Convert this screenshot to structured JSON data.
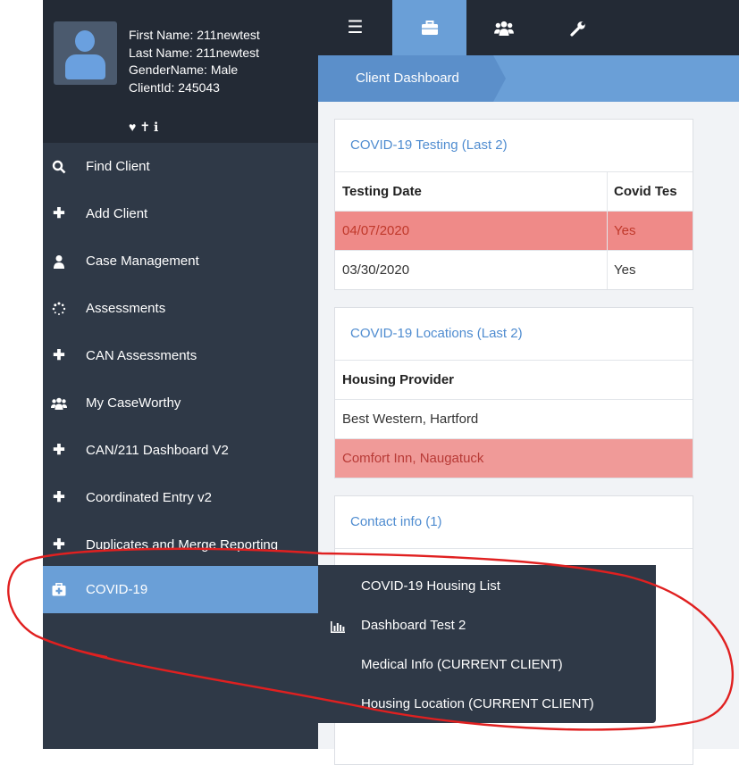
{
  "profile": {
    "first_name": "First Name: 211newtest",
    "last_name": "Last Name: 211newtest",
    "gender": "GenderName: Male",
    "client_id": "ClientId: 245043",
    "icons": [
      "heart-icon",
      "person-icon",
      "info-icon"
    ]
  },
  "sidebar": {
    "items": [
      {
        "label": "Find Client",
        "icon": "search-icon"
      },
      {
        "label": "Add Client",
        "icon": "plus-icon"
      },
      {
        "label": "Case Management",
        "icon": "user-icon"
      },
      {
        "label": "Assessments",
        "icon": "spinner-icon"
      },
      {
        "label": "CAN Assessments",
        "icon": "plus-icon"
      },
      {
        "label": "My CaseWorthy",
        "icon": "users-icon"
      },
      {
        "label": "CAN/211 Dashboard V2",
        "icon": "plus-icon"
      },
      {
        "label": "Coordinated Entry v2",
        "icon": "plus-icon"
      },
      {
        "label": "Duplicates and Merge Reporting",
        "icon": "plus-icon"
      },
      {
        "label": "COVID-19",
        "icon": "medkit-icon",
        "active": true
      }
    ]
  },
  "topbar": {
    "buttons": [
      "menu-icon",
      "briefcase-icon",
      "users-icon",
      "wrench-icon"
    ],
    "active_index": 1
  },
  "breadcrumb": {
    "label": "Client Dashboard"
  },
  "panels": {
    "testing": {
      "title": "COVID-19 Testing (Last 2)",
      "headers": [
        "Testing Date",
        "Covid Tes"
      ],
      "rows": [
        {
          "date": "04/07/2020",
          "value": "Yes",
          "highlight": true
        },
        {
          "date": "03/30/2020",
          "value": "Yes",
          "highlight": false
        }
      ]
    },
    "locations": {
      "title": "COVID-19 Locations (Last 2)",
      "header": "Housing Provider",
      "rows": [
        {
          "provider": "Best Western, Hartford",
          "highlight": false
        },
        {
          "provider": "Comfort Inn, Naugatuck",
          "highlight": true
        }
      ]
    },
    "contact": {
      "title": "Contact info (1)"
    }
  },
  "submenu": {
    "items": [
      {
        "label": "COVID-19 Housing List",
        "icon": ""
      },
      {
        "label": "Dashboard Test 2",
        "icon": "bar-chart-icon"
      },
      {
        "label": "Medical Info (CURRENT CLIENT)",
        "icon": ""
      },
      {
        "label": "Housing Location (CURRENT CLIENT)",
        "icon": ""
      }
    ]
  },
  "colors": {
    "sidebar": "#2f3947",
    "profile": "#232a35",
    "accent": "#6a9fd7",
    "highlight_row": "#ef8a88",
    "annotation": "#e02020"
  }
}
